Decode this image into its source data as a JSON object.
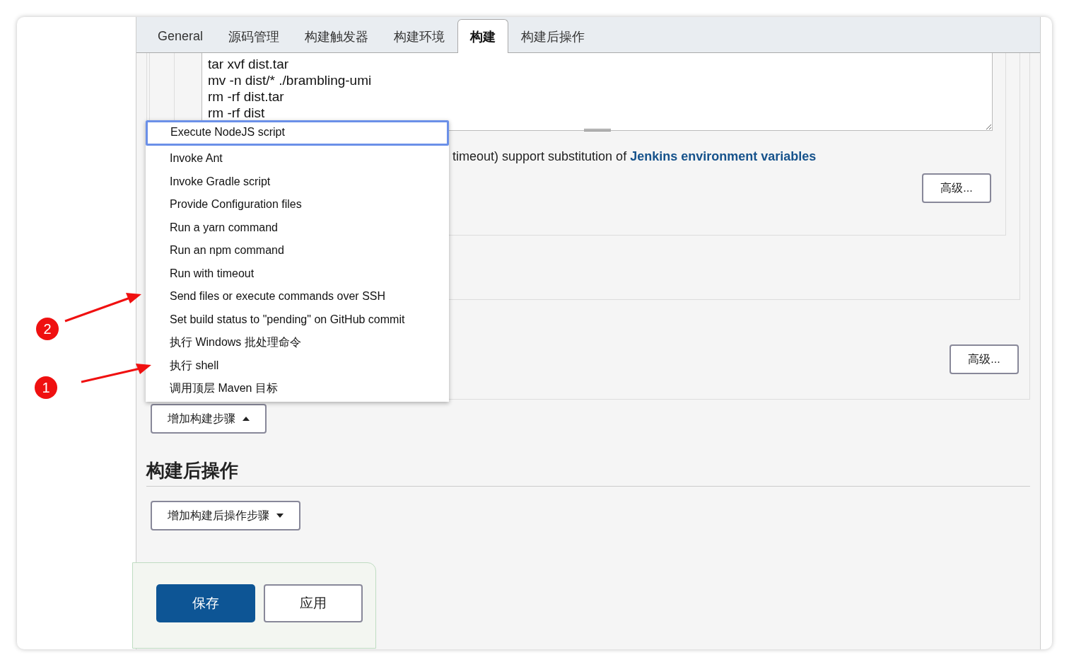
{
  "tabs": [
    {
      "label": "General",
      "selected": false
    },
    {
      "label": "源码管理",
      "selected": false
    },
    {
      "label": "构建触发器",
      "selected": false
    },
    {
      "label": "构建环境",
      "selected": false
    },
    {
      "label": "构建",
      "selected": true
    },
    {
      "label": "构建后操作",
      "selected": false
    }
  ],
  "script": {
    "lines": [
      "tar xvf dist.tar",
      "mv -n dist/* ./brambling-umi",
      "rm -rf dist.tar",
      "rm -rf dist"
    ]
  },
  "help_text": {
    "text": "timeout) support substitution of ",
    "link": "Jenkins environment variables"
  },
  "advanced_buttons": [
    "高级...",
    "高级..."
  ],
  "add_build_step_button": {
    "label": "增加构建步骤",
    "expanded": true
  },
  "build_step_menu": [
    {
      "label": "Execute NodeJS script",
      "selected": true
    },
    {
      "label": "Invoke Ant",
      "selected": false
    },
    {
      "label": "Invoke Gradle script",
      "selected": false
    },
    {
      "label": "Provide Configuration files",
      "selected": false
    },
    {
      "label": "Run a yarn command",
      "selected": false
    },
    {
      "label": "Run an npm command",
      "selected": false
    },
    {
      "label": "Run with timeout",
      "selected": false
    },
    {
      "label": "Send files or execute commands over SSH",
      "selected": false
    },
    {
      "label": "Set build status to \"pending\" on GitHub commit",
      "selected": false
    },
    {
      "label": "执行 Windows 批处理命令",
      "selected": false
    },
    {
      "label": "执行 shell",
      "selected": false
    },
    {
      "label": "调用顶层 Maven 目标",
      "selected": false
    }
  ],
  "post_build": {
    "heading": "构建后操作",
    "add_button": {
      "label": "增加构建后操作步骤",
      "expanded": false
    }
  },
  "actions": {
    "save": "保存",
    "apply": "应用"
  },
  "annotations": [
    {
      "number": "2"
    },
    {
      "number": "1"
    }
  ]
}
